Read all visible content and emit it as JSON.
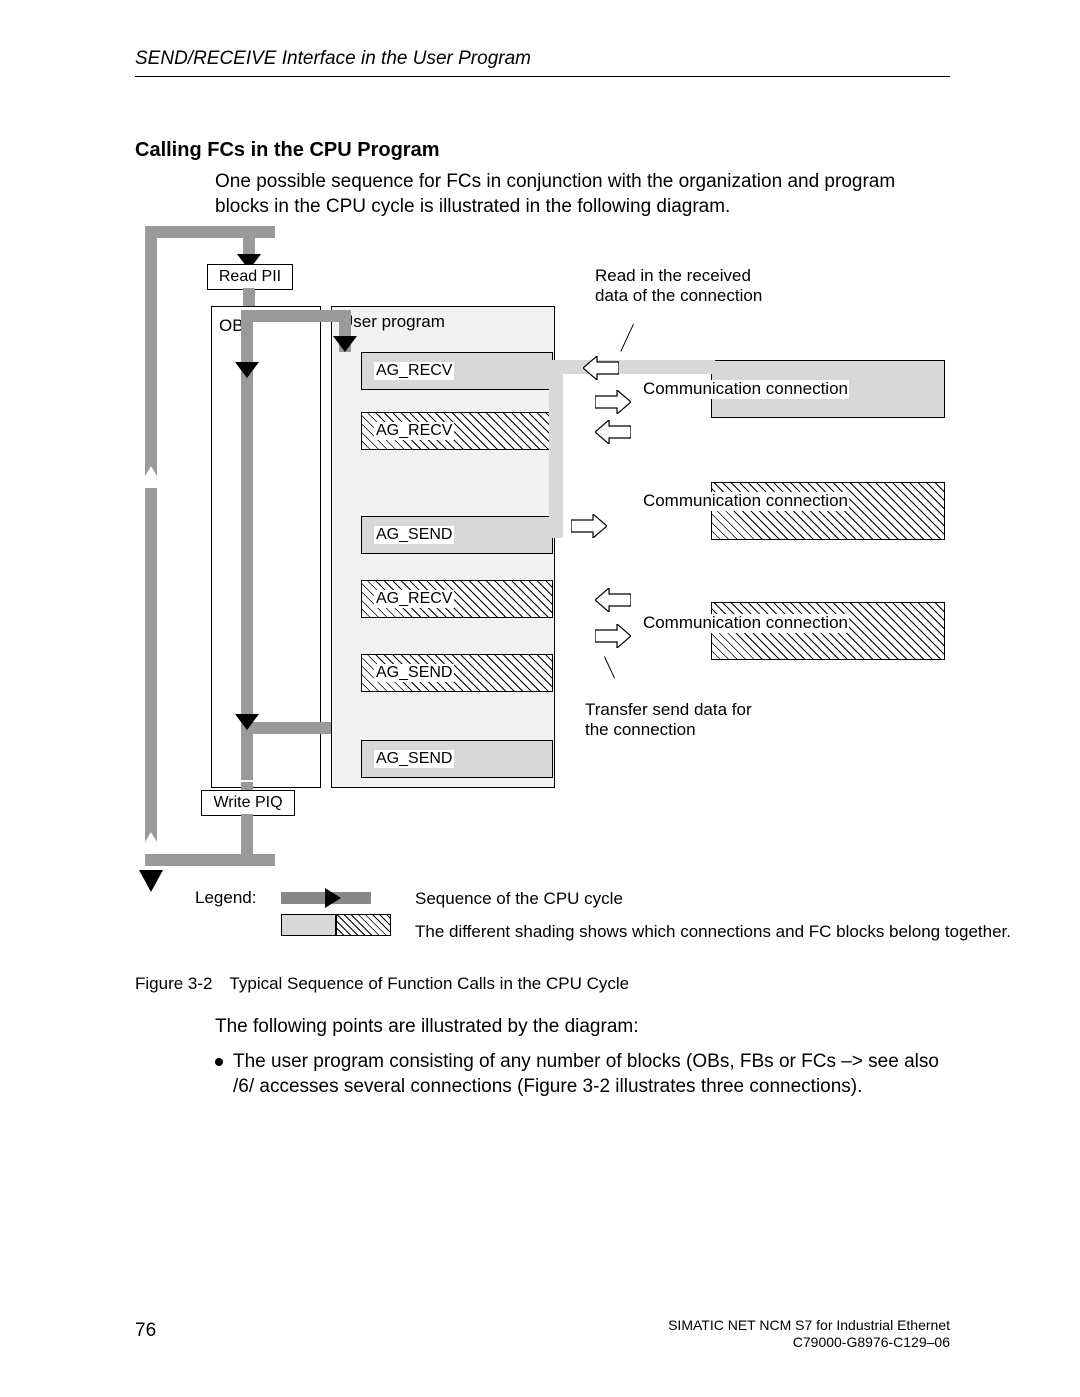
{
  "running_head": "SEND/RECEIVE Interface in the User Program",
  "heading": "Calling FCs in the CPU Program",
  "intro": "One possible sequence for FCs in conjunction with the organization and program blocks in the CPU cycle is illustrated in the following diagram.",
  "diagram": {
    "read_pii": "Read PII",
    "write_piq": "Write PIQ",
    "ob_label": "OB",
    "user_program": "User program",
    "fc_blocks": [
      "AG_RECV",
      "AG_RECV",
      "AG_SEND",
      "AG_RECV",
      "AG_SEND",
      "AG_SEND"
    ],
    "conn_label": "Communication connection",
    "annot_read": "Read in the received data of the connection",
    "annot_send": "Transfer send data for the connection"
  },
  "legend": {
    "label": "Legend:",
    "seq": "Sequence of the CPU cycle",
    "shading": "The different shading shows which connections and FC blocks belong together."
  },
  "figure": {
    "label": "Figure 3-2",
    "caption": "Typical Sequence of  Function Calls in the CPU Cycle"
  },
  "body": {
    "p1": "The following points are illustrated by the diagram:",
    "bullet1": "The user program consisting of any number of blocks (OBs, FBs or FCs –> see also /6/ accesses several  connections (Figure 3-2 illustrates three connections)."
  },
  "footer": {
    "page": "76",
    "line1": "SIMATIC NET NCM S7 for Industrial Ethernet",
    "line2": "C79000-G8976-C129–06"
  }
}
